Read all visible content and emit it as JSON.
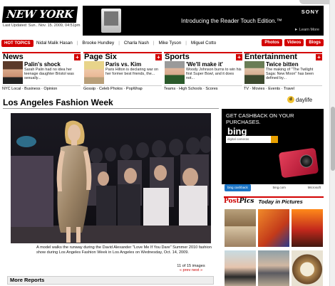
{
  "header": {
    "logo": "NEW YORK POST",
    "updated": "Last Updated: Sun., Nov. 15, 2009, 04:51pm"
  },
  "top_ad": {
    "text": "Introducing the Reader Touch Edition.™",
    "brand": "SONY",
    "link": "► Learn More"
  },
  "hot_topics": {
    "label": "HOT TOPICS",
    "links": [
      "Nidal Malik Hasan",
      "Brooke Hundley",
      "Charla Nash",
      "Mike Tyson",
      "Miguel Cotto"
    ],
    "buttons": [
      "Photos",
      "Videos",
      "Blogs"
    ]
  },
  "sections": [
    {
      "name": "News",
      "headline": "Palin's shock",
      "text": "Sarah Palin had no idea her teenage daughter Bristol was sexually...",
      "links": "NYC Local · Business · Opinion"
    },
    {
      "name": "Page Six",
      "headline": "Paris vs. Kim",
      "text": "Paris Hilton is declaring war on her former best friends, the...",
      "links": "Gossip · Celeb Photos · PopWrap"
    },
    {
      "name": "Sports",
      "headline": "'We'll make it'",
      "text": "Woody Johnson burns to win his first Super Bowl, and it does not...",
      "links": "Teams · High Schools · Scores"
    },
    {
      "name": "Entertainment",
      "headline": "Twice bitten",
      "text": "The making of \"The Twilight Saga: New Moon\" has been defined by...",
      "links": "TV · Movies · Events · Travel"
    }
  ],
  "article": {
    "title": "Los Angeles Fashion Week",
    "caption": "A model walks the runway during the David Alexander \"Love Me If You Dare\" Summer 2010 fashion show during Los Angeles Fashion Week in Los Angeles on Wednesday, Oct. 14, 2009.",
    "counter": "11 of 15 images",
    "nav": "« prev next »"
  },
  "daylife": "daylife",
  "bing_ad": {
    "headline": "GET CASHBACK ON YOUR PURCHASES.",
    "logo": "bing",
    "search": "digital cameras",
    "footer_left": "bing cashback",
    "footer_mid": "bing.com",
    "footer_right": "Microsoft"
  },
  "postpics": {
    "logo_post": "Post",
    "logo_pics": "Pics",
    "subtitle": "Today in Pictures"
  },
  "more_reports": "More Reports",
  "colors": {
    "accent": "#d30000"
  }
}
